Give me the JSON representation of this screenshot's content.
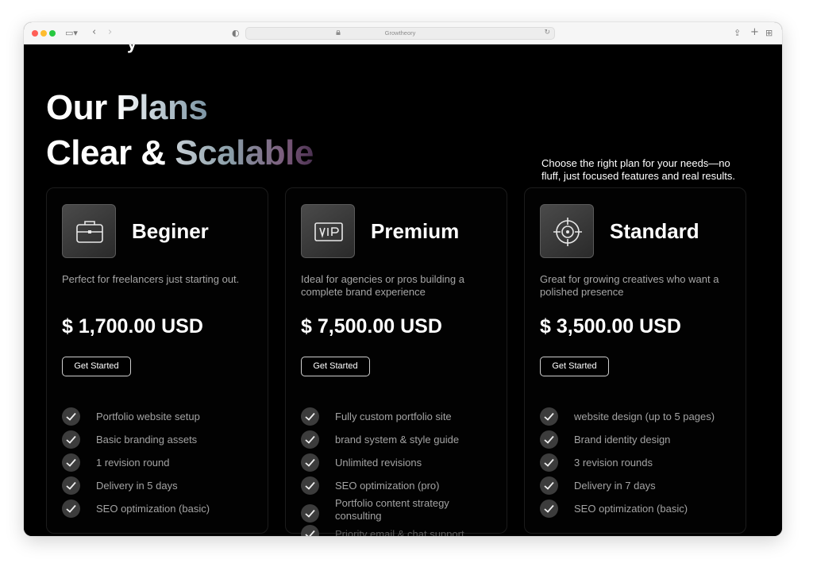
{
  "browser": {
    "url": "Growtheory"
  },
  "hero": {
    "title_line1_a": "Our ",
    "title_line1_b": "Plans",
    "title_line2_a": "Clear & ",
    "title_line2_b": "Scalable",
    "intro": "Choose the right plan for your needs—no fluff, just focused features and real results."
  },
  "plans": [
    {
      "name": "Beginer",
      "icon": "briefcase-icon",
      "description": "Perfect for freelancers just starting out.",
      "price": "$ 1,700.00 USD",
      "cta": "Get Started",
      "features": [
        "Portfolio website setup",
        "Basic branding assets",
        "1 revision round",
        "Delivery in 5 days",
        "SEO optimization (basic)"
      ]
    },
    {
      "name": "Premium",
      "icon": "vip-icon",
      "description": "Ideal for agencies or pros building a complete brand experience",
      "price": "$ 7,500.00 USD",
      "cta": "Get Started",
      "features": [
        "Fully custom portfolio site",
        "brand system & style guide",
        "Unlimited revisions",
        "SEO optimization (pro)",
        "Portfolio content strategy consulting",
        "Priority email & chat support"
      ]
    },
    {
      "name": "Standard",
      "icon": "target-icon",
      "description": "Great for growing creatives who want a polished presence",
      "price": "$ 3,500.00 USD",
      "cta": "Get Started",
      "features": [
        "website design (up to 5 pages)",
        "Brand identity design",
        "3 revision rounds",
        "Delivery in 7 days",
        "SEO optimization (basic)"
      ]
    }
  ]
}
